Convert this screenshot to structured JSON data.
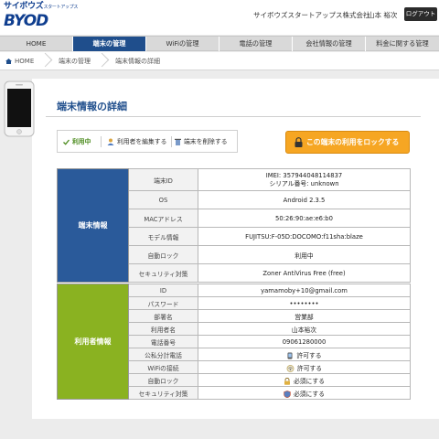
{
  "header": {
    "logo_top": "サイボウズ",
    "logo_small": "スタートアップス",
    "logo_bottom": "BYOD",
    "company": "サイボウズスタートアップス株式会社",
    "user": "山本 裕次",
    "logout": "ログアウト"
  },
  "nav": {
    "items": [
      "HOME",
      "端末の管理",
      "WiFiの管理",
      "電話の管理",
      "会社情報の管理",
      "料金に関する管理"
    ],
    "active_index": 1
  },
  "breadcrumb": [
    "HOME",
    "端末の管理",
    "端末情報の詳細"
  ],
  "page": {
    "title": "端末情報の詳細",
    "status": "利用中",
    "edit_user": "利用者を編集する",
    "delete_device": "端末を削除する",
    "lock_button": "この端末の利用をロックする"
  },
  "device": {
    "section": "端末情報",
    "rows": [
      {
        "label": "端末ID",
        "value": "IMEI: 357944048114837",
        "value2": "シリアル番号: unknown"
      },
      {
        "label": "OS",
        "value": "Android 2.3.5"
      },
      {
        "label": "MACアドレス",
        "value": "50:26:90:ae:e6:b0"
      },
      {
        "label": "モデル情報",
        "value": "FUJITSU:F-05D:DOCOMO:f11sha:blaze"
      },
      {
        "label": "自動ロック",
        "value": "利用中"
      },
      {
        "label": "セキュリティ対策",
        "value": "Zoner AntiVirus Free (free)"
      }
    ]
  },
  "user": {
    "section": "利用者情報",
    "rows": [
      {
        "label": "ID",
        "value": "yamamoby+10@gmail.com"
      },
      {
        "label": "パスワード",
        "value": "••••••••"
      },
      {
        "label": "部署名",
        "value": "営業部"
      },
      {
        "label": "利用者名",
        "value": "山本裕次"
      },
      {
        "label": "電話番号",
        "value": "09061280000"
      },
      {
        "label": "公私分計電話",
        "value": "許可する",
        "icon": "phone-icon"
      },
      {
        "label": "WiFiの接続",
        "value": "許可する",
        "icon": "wifi-icon"
      },
      {
        "label": "自動ロック",
        "value": "必須にする",
        "icon": "lock-icon"
      },
      {
        "label": "セキュリティ対策",
        "value": "必須にする",
        "icon": "shield-icon"
      }
    ]
  },
  "colors": {
    "brand": "#0f3e8f",
    "nav_active": "#1f4e8c",
    "device_section": "#2a5a9a",
    "user_section": "#8ab221",
    "lock_button": "#f6a623"
  }
}
